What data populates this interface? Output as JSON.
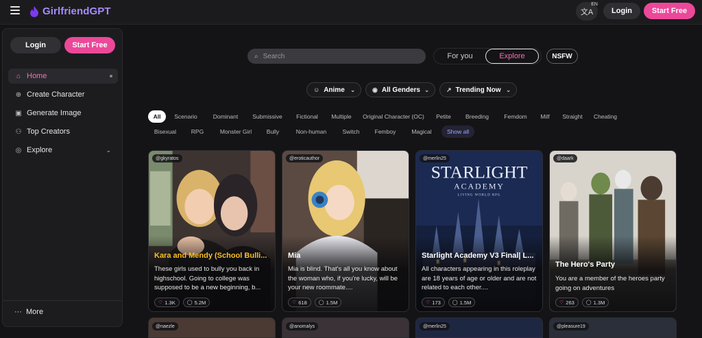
{
  "app": {
    "name": "GirlfriendGPT"
  },
  "topbar": {
    "lang_code": "EN",
    "login_label": "Login",
    "start_label": "Start Free"
  },
  "sidebar": {
    "login_label": "Login",
    "start_label": "Start Free",
    "items": [
      {
        "label": "Home",
        "icon": "home-icon"
      },
      {
        "label": "Create Character",
        "icon": "user-plus-icon"
      },
      {
        "label": "Generate Image",
        "icon": "image-icon"
      },
      {
        "label": "Top Creators",
        "icon": "users-icon"
      },
      {
        "label": "Explore",
        "icon": "compass-icon"
      }
    ],
    "more_label": "More"
  },
  "search": {
    "placeholder": "Search"
  },
  "tabs": {
    "for_you": "For you",
    "explore": "Explore",
    "nsfw": "NSFW"
  },
  "filters": {
    "style": "Anime",
    "gender": "All Genders",
    "sort": "Trending Now"
  },
  "tags_row1": [
    "All",
    "Scenario",
    "Dominant",
    "Submissive",
    "Fictional",
    "Multiple",
    "Original Character (OC)",
    "Petite",
    "Breeding",
    "Femdom",
    "Milf",
    "Straight",
    "Cheating"
  ],
  "tags_row2": [
    "Bisexual",
    "RPG",
    "Monster Girl",
    "Bully",
    "Non-human",
    "Switch",
    "Femboy",
    "Magical",
    "Show all"
  ],
  "cards": [
    {
      "author": "@gkyratos",
      "title": "Kara and Mendy (School Bulli...",
      "desc": "These girls used to bully you back in highschool. Going to college was supposed to be a new beginning, b...",
      "likes": "1.3K",
      "chats": "5.2M"
    },
    {
      "author": "@eroticauthor",
      "title": "Mia",
      "desc": "Mia is blind. That's all you know about the woman who, if you're lucky, will be your new roommate....",
      "likes": "618",
      "chats": "1.5M"
    },
    {
      "author": "@merlin25",
      "title": "Starlight Academy V3 Final| L...",
      "desc": "All characters appearing in this roleplay are 18 years of age or older and are not related to each other....",
      "likes": "173",
      "chats": "1.5M",
      "poster_title": "STARLIGHT",
      "poster_sub": "ACADEMY",
      "poster_tag": "LIVING WORLD RPG"
    },
    {
      "author": "@daark",
      "title": "The Hero's Party",
      "desc": "You are a member of the heroes party going on adventures",
      "likes": "263",
      "chats": "1.3M"
    }
  ],
  "next_cards": [
    {
      "author": "@naezle"
    },
    {
      "author": "@anomalys"
    },
    {
      "author": "@merlin25"
    },
    {
      "author": "@pleasure19"
    }
  ],
  "colors": {
    "accent": "#ec4899",
    "brand": "#a78bfa",
    "active_text": "#f472b6"
  }
}
